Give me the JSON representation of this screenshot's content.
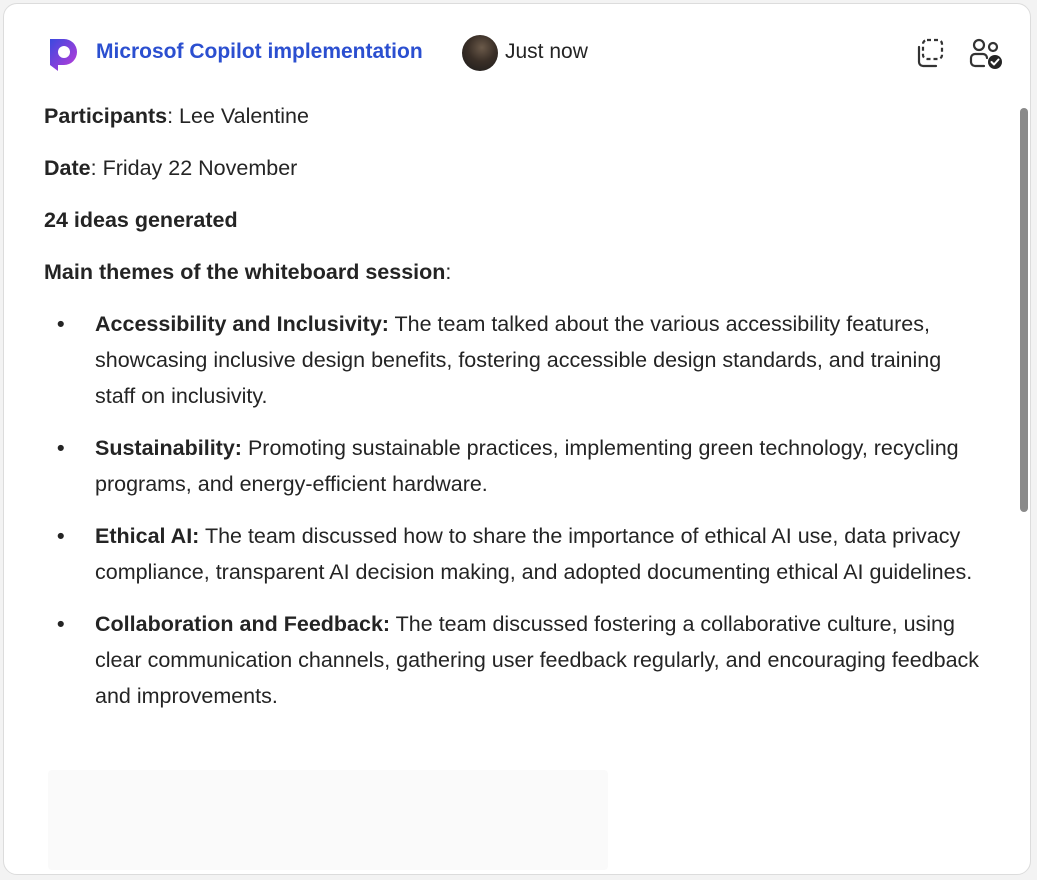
{
  "header": {
    "app_name": "Microsof Copilot implementation",
    "timestamp": "Just now",
    "icons": {
      "logo": "copilot-logo-icon",
      "copy": "copy-icon",
      "share": "people-check-icon"
    },
    "colors": {
      "app_name": "#2b4fd0",
      "logo_gradient_start": "#3b49df",
      "logo_gradient_end": "#c13bd8"
    }
  },
  "summary": {
    "participants_label": "Participants",
    "participants_value": "Lee Valentine",
    "date_label": "Date",
    "date_value": "Friday 22 November",
    "ideas_count": "24 ideas generated",
    "themes_heading": "Main themes of the whiteboard session",
    "themes": [
      {
        "title": "Accessibility and Inclusivity:",
        "text": "The team talked about the various accessibility features, showcasing inclusive design benefits, fostering accessible design standards, and training staff on inclusivity."
      },
      {
        "title": "Sustainability:",
        "text": "Promoting sustainable practices, implementing green technology, recycling programs, and energy-efficient hardware."
      },
      {
        "title": "Ethical AI:",
        "text": "The team discussed how to share the importance of ethical AI use, data privacy compliance, transparent AI decision making, and adopted documenting ethical AI guidelines."
      },
      {
        "title": "Collaboration and Feedback:",
        "text": "The team discussed fostering a collaborative culture, using clear communication channels, gathering user feedback regularly, and encouraging feedback and improvements."
      }
    ]
  }
}
